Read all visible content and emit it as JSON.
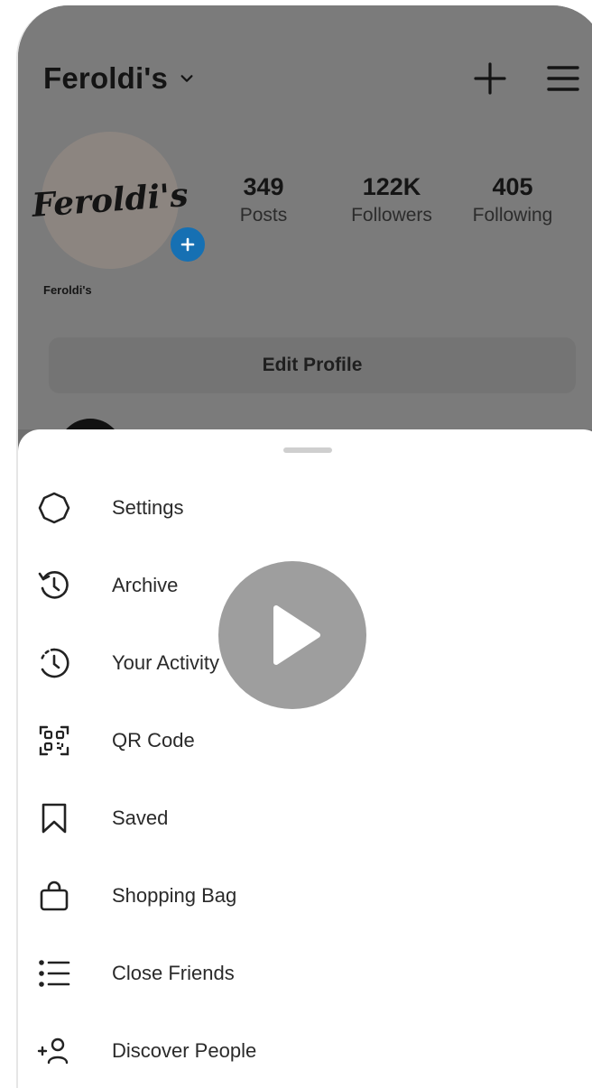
{
  "profile": {
    "account_name": "Feroldi's",
    "avatar_text": "Feroldi's",
    "handle": "Feroldi's",
    "edit_profile_label": "Edit Profile"
  },
  "stats": [
    {
      "value": "349",
      "label": "Posts"
    },
    {
      "value": "122K",
      "label": "Followers"
    },
    {
      "value": "405",
      "label": "Following"
    }
  ],
  "menu": [
    {
      "label": "Settings",
      "icon": "gear-icon"
    },
    {
      "label": "Archive",
      "icon": "archive-history-icon"
    },
    {
      "label": "Your Activity",
      "icon": "activity-clock-icon"
    },
    {
      "label": "QR Code",
      "icon": "qr-code-icon"
    },
    {
      "label": "Saved",
      "icon": "bookmark-icon"
    },
    {
      "label": "Shopping Bag",
      "icon": "shopping-bag-icon"
    },
    {
      "label": "Close Friends",
      "icon": "close-friends-list-icon"
    },
    {
      "label": "Discover People",
      "icon": "add-person-icon"
    }
  ],
  "colors": {
    "badge_blue": "#1670b3",
    "overlay_gray": "#7b7b7b",
    "text_dark": "#141414"
  }
}
